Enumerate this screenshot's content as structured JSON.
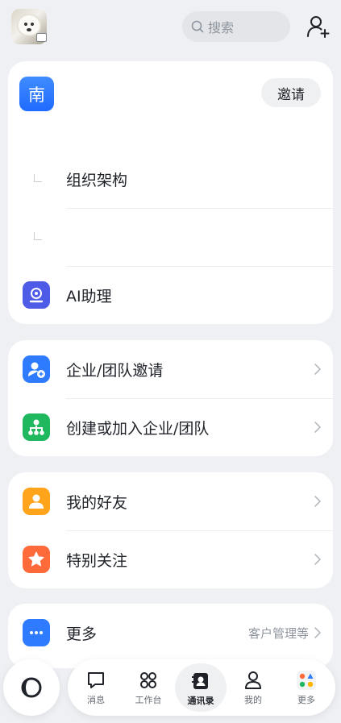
{
  "header": {
    "search_placeholder": "搜索",
    "avatar_icon": "dog-photo-avatar",
    "device_badge_icon": "monitor-icon",
    "add_contact_icon": "add-person-icon"
  },
  "org_card": {
    "badge_char": "南",
    "invite_label": "邀请",
    "items": [
      {
        "label": "组织架构"
      },
      {
        "label": ""
      },
      {
        "label": "AI助理",
        "icon": "ai-assistant-icon",
        "color": "#4e5be6"
      }
    ]
  },
  "team_card": {
    "items": [
      {
        "label": "企业/团队邀请",
        "icon": "invite-team-icon",
        "color": "#2f7bff"
      },
      {
        "label": "创建或加入企业/团队",
        "icon": "org-tree-icon",
        "color": "#1fb85f"
      }
    ]
  },
  "friends_card": {
    "items": [
      {
        "label": "我的好友",
        "icon": "friend-icon",
        "color": "#ffa41b"
      },
      {
        "label": "特别关注",
        "icon": "star-icon",
        "color": "#ff6a3a"
      }
    ]
  },
  "more_card": {
    "label": "更多",
    "sub": "客户管理等",
    "icon": "more-dots-icon",
    "color": "#2f7bff"
  },
  "tabbar": {
    "tabs": [
      {
        "label": "消息",
        "icon": "message-icon"
      },
      {
        "label": "工作台",
        "icon": "workbench-icon"
      },
      {
        "label": "通讯录",
        "icon": "contacts-icon",
        "active": true
      },
      {
        "label": "我的",
        "icon": "profile-icon"
      },
      {
        "label": "更多",
        "icon": "more-apps-icon"
      }
    ]
  }
}
